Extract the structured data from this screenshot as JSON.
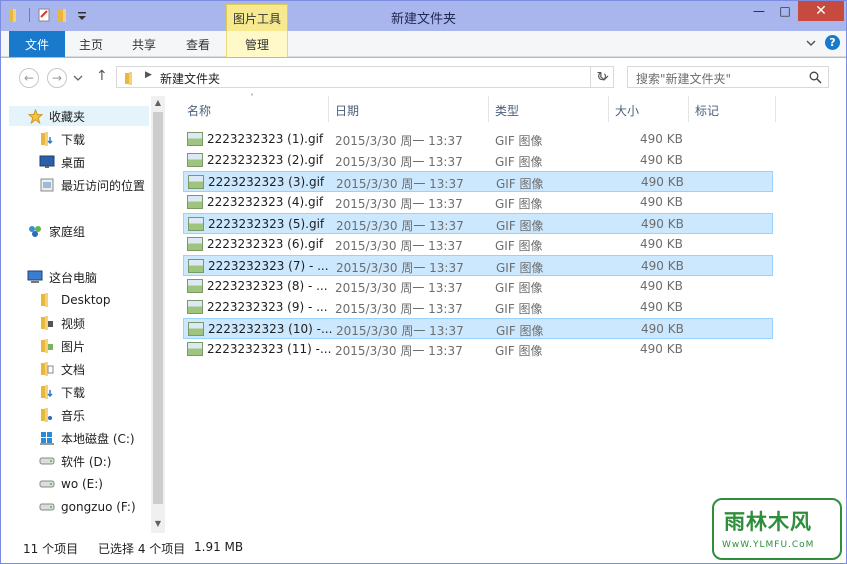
{
  "window": {
    "title": "新建文件夹"
  },
  "context_tab_group": "图片工具",
  "ribbon": {
    "tabs": [
      {
        "label": "文件"
      },
      {
        "label": "主页"
      },
      {
        "label": "共享"
      },
      {
        "label": "查看"
      },
      {
        "label": "管理"
      }
    ]
  },
  "address": {
    "path": "新建文件夹",
    "search_placeholder": "搜索\"新建文件夹\""
  },
  "nav": {
    "favorites_label": "收藏夹",
    "favorites": [
      "下载",
      "桌面",
      "最近访问的位置"
    ],
    "homegroup_label": "家庭组",
    "thispc_label": "这台电脑",
    "thispc": [
      "Desktop",
      "视频",
      "图片",
      "文档",
      "下载",
      "音乐",
      "本地磁盘 (C:)",
      "软件 (D:)",
      "wo (E:)",
      "gongzuo (F:)"
    ]
  },
  "columns": [
    "名称",
    "日期",
    "类型",
    "大小",
    "标记"
  ],
  "files": [
    {
      "name": "2223232323 (1).gif",
      "date": "2015/3/30 周一 13:37",
      "type": "GIF 图像",
      "size": "490 KB",
      "selected": false
    },
    {
      "name": "2223232323 (2).gif",
      "date": "2015/3/30 周一 13:37",
      "type": "GIF 图像",
      "size": "490 KB",
      "selected": false
    },
    {
      "name": "2223232323 (3).gif",
      "date": "2015/3/30 周一 13:37",
      "type": "GIF 图像",
      "size": "490 KB",
      "selected": true
    },
    {
      "name": "2223232323 (4).gif",
      "date": "2015/3/30 周一 13:37",
      "type": "GIF 图像",
      "size": "490 KB",
      "selected": false
    },
    {
      "name": "2223232323 (5).gif",
      "date": "2015/3/30 周一 13:37",
      "type": "GIF 图像",
      "size": "490 KB",
      "selected": true
    },
    {
      "name": "2223232323 (6).gif",
      "date": "2015/3/30 周一 13:37",
      "type": "GIF 图像",
      "size": "490 KB",
      "selected": false
    },
    {
      "name": "2223232323 (7) - ...",
      "date": "2015/3/30 周一 13:37",
      "type": "GIF 图像",
      "size": "490 KB",
      "selected": true
    },
    {
      "name": "2223232323 (8) - ...",
      "date": "2015/3/30 周一 13:37",
      "type": "GIF 图像",
      "size": "490 KB",
      "selected": false
    },
    {
      "name": "2223232323 (9) - ...",
      "date": "2015/3/30 周一 13:37",
      "type": "GIF 图像",
      "size": "490 KB",
      "selected": false
    },
    {
      "name": "2223232323 (10) -...",
      "date": "2015/3/30 周一 13:37",
      "type": "GIF 图像",
      "size": "490 KB",
      "selected": true
    },
    {
      "name": "2223232323 (11) -...",
      "date": "2015/3/30 周一 13:37",
      "type": "GIF 图像",
      "size": "490 KB",
      "selected": false
    }
  ],
  "status": {
    "count": "11 个项目",
    "selection": "已选择 4 个项目",
    "size": "1.91 MB"
  },
  "watermark": {
    "title": "雨林木风",
    "url": "WwW.YLMFU.CoM"
  }
}
